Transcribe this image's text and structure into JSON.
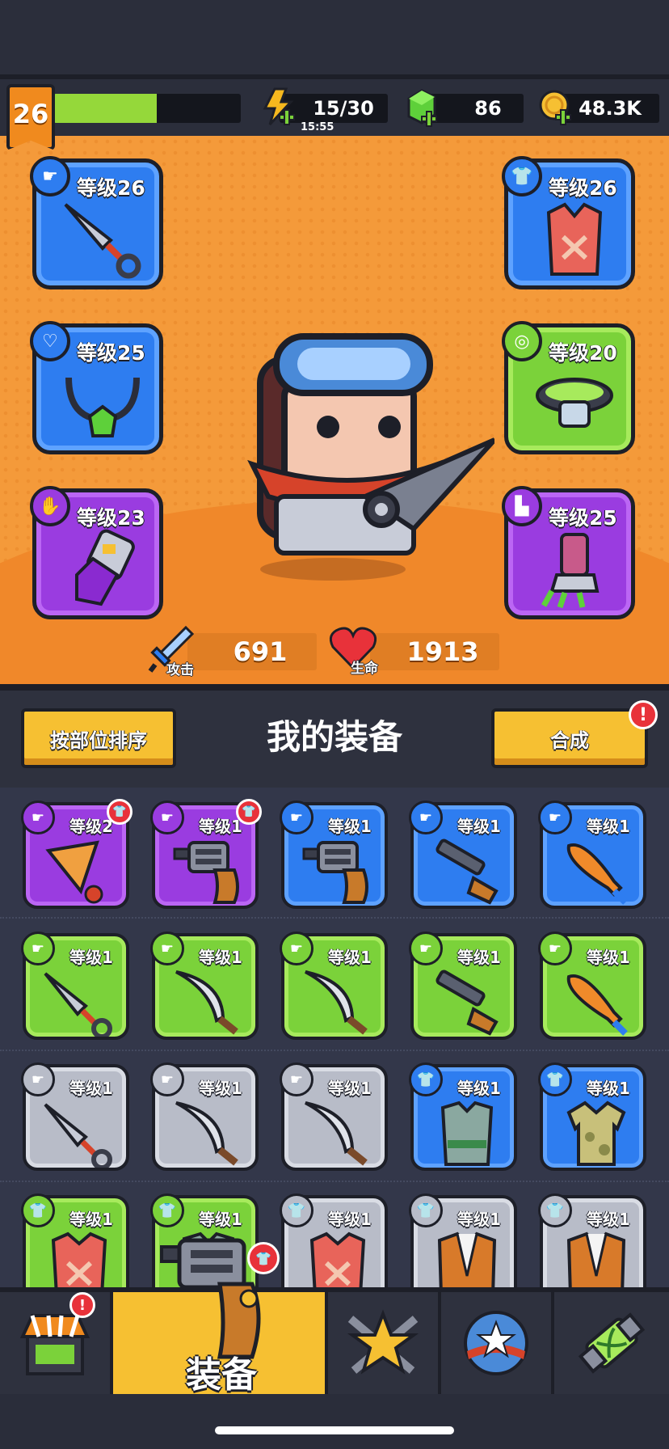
{
  "player": {
    "level": "26",
    "xp_fraction": 0.55
  },
  "resources": {
    "energy": {
      "value": "15/30",
      "timer": "15:55",
      "icon": "lightning-plus-icon"
    },
    "gems": {
      "value": "86",
      "icon": "green-gem-plus-icon"
    },
    "coins": {
      "value": "48.3K",
      "icon": "gold-coin-plus-icon"
    }
  },
  "equipped": [
    {
      "slot": "weapon",
      "label": "等级26",
      "rarity": "blue",
      "type_icon": "weapon-type-icon",
      "item_icon": "kunai-icon"
    },
    {
      "slot": "necklace",
      "label": "等级25",
      "rarity": "blue",
      "type_icon": "necklace-type-icon",
      "item_icon": "gem-necklace-icon"
    },
    {
      "slot": "gloves",
      "label": "等级23",
      "rarity": "purple",
      "type_icon": "glove-type-icon",
      "item_icon": "mech-gauntlet-icon"
    },
    {
      "slot": "armor",
      "label": "等级26",
      "rarity": "blue",
      "type_icon": "armor-type-icon",
      "item_icon": "leather-vest-icon"
    },
    {
      "slot": "belt",
      "label": "等级20",
      "rarity": "green",
      "type_icon": "belt-type-icon",
      "item_icon": "belt-icon"
    },
    {
      "slot": "boots",
      "label": "等级25",
      "rarity": "purple",
      "type_icon": "boot-type-icon",
      "item_icon": "claw-boot-icon"
    }
  ],
  "stats": {
    "attack": {
      "label": "攻击",
      "value": "691",
      "icon": "sword-icon"
    },
    "health": {
      "label": "生命",
      "value": "1913",
      "icon": "heart-icon"
    }
  },
  "equip_panel": {
    "sort_button": "按部位排序",
    "title": "我的装备",
    "merge_button": "合成",
    "alert": "!"
  },
  "inventory": [
    {
      "label": "等级2",
      "rarity": "purple",
      "type": "weapon",
      "art": "drill-icon",
      "badge": true
    },
    {
      "label": "等级1",
      "rarity": "purple",
      "type": "weapon",
      "art": "revolver-icon",
      "badge": true
    },
    {
      "label": "等级1",
      "rarity": "blue",
      "type": "weapon",
      "art": "revolver-icon",
      "badge": false
    },
    {
      "label": "等级1",
      "rarity": "blue",
      "type": "weapon",
      "art": "shotgun-icon",
      "badge": false
    },
    {
      "label": "等级1",
      "rarity": "blue",
      "type": "weapon",
      "art": "bat-icon",
      "badge": false
    },
    {
      "label": "等级1",
      "rarity": "green",
      "type": "weapon",
      "art": "kunai-icon",
      "badge": false
    },
    {
      "label": "等级1",
      "rarity": "green",
      "type": "weapon",
      "art": "machete-icon",
      "badge": false
    },
    {
      "label": "等级1",
      "rarity": "green",
      "type": "weapon",
      "art": "machete-icon",
      "badge": false
    },
    {
      "label": "等级1",
      "rarity": "green",
      "type": "weapon",
      "art": "shotgun-icon",
      "badge": false
    },
    {
      "label": "等级1",
      "rarity": "green",
      "type": "weapon",
      "art": "bat-icon",
      "badge": false
    },
    {
      "label": "等级1",
      "rarity": "gray",
      "type": "weapon",
      "art": "kunai-icon",
      "badge": false
    },
    {
      "label": "等级1",
      "rarity": "gray",
      "type": "weapon",
      "art": "machete-icon",
      "badge": false
    },
    {
      "label": "等级1",
      "rarity": "gray",
      "type": "weapon",
      "art": "machete-icon",
      "badge": false
    },
    {
      "label": "等级1",
      "rarity": "blue",
      "type": "armor",
      "art": "body-armor-icon",
      "badge": false
    },
    {
      "label": "等级1",
      "rarity": "blue",
      "type": "armor",
      "art": "camo-shirt-icon",
      "badge": false
    },
    {
      "label": "等级1",
      "rarity": "green",
      "type": "armor",
      "art": "leather-vest-icon",
      "badge": false
    },
    {
      "label": "等级1",
      "rarity": "green",
      "type": "armor",
      "art": "body-armor-icon",
      "badge": false
    },
    {
      "label": "等级1",
      "rarity": "gray",
      "type": "armor",
      "art": "leather-vest-icon",
      "badge": false
    },
    {
      "label": "等级1",
      "rarity": "gray",
      "type": "armor",
      "art": "jacket-icon",
      "badge": false
    },
    {
      "label": "等级1",
      "rarity": "gray",
      "type": "armor",
      "art": "jacket-icon",
      "badge": false
    }
  ],
  "nav": {
    "tabs": [
      {
        "name": "shop",
        "icon": "shop-stall-icon",
        "alert": "!"
      },
      {
        "name": "equipment",
        "label": "装备",
        "icon": "revolver-icon",
        "active": true
      },
      {
        "name": "battle",
        "icon": "crossed-swords-star-icon"
      },
      {
        "name": "talents",
        "icon": "star-ball-icon"
      },
      {
        "name": "evolution",
        "icon": "dna-capsule-icon"
      }
    ]
  },
  "colors": {
    "hero_bg": "#f49a3a",
    "blue": "#2e7df0",
    "green": "#7bd23a",
    "purple": "#9a3ce0",
    "gray": "#b8bcc8",
    "yellow": "#f6c032",
    "dark": "#1d1f28"
  }
}
